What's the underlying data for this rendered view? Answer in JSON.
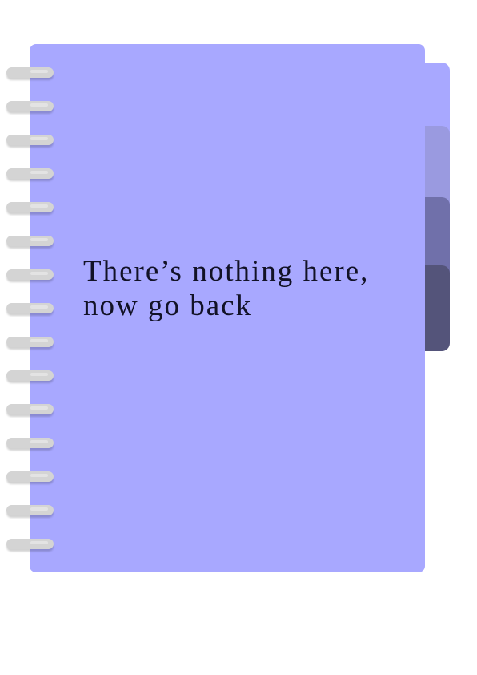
{
  "notebook": {
    "message_line1": "There’s nothing here,",
    "message_line2": "now go back",
    "colors": {
      "cover": "#a8a8ff",
      "tabs": [
        "#a8a8ff",
        "#9a9ae0",
        "#7070aa",
        "#54547a"
      ],
      "rings": "#d4d4d4",
      "text": "#121226"
    },
    "ring_count": 15,
    "tab_count": 4
  }
}
